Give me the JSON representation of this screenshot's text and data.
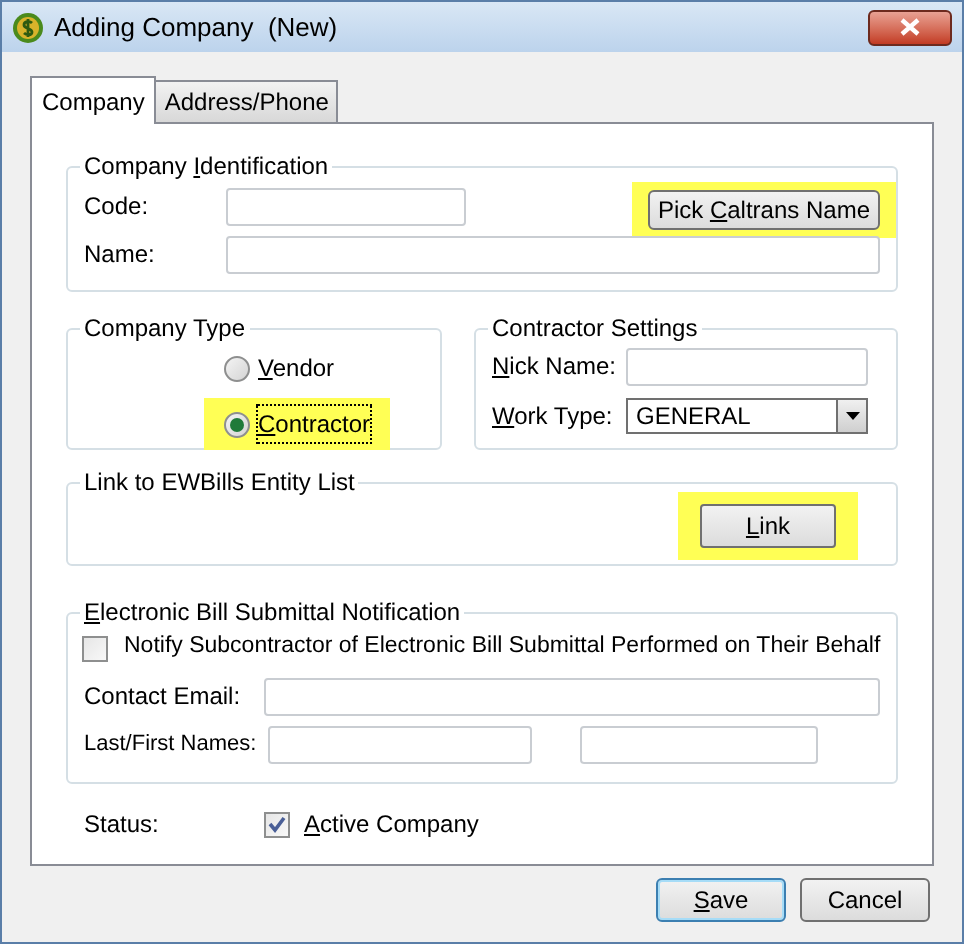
{
  "window": {
    "title": "Adding Company  (New)"
  },
  "tabs": [
    {
      "label": "Company",
      "selected": true
    },
    {
      "label": "Address/Phone",
      "selected": false
    }
  ],
  "company_identification": {
    "title": {
      "text": "Company ",
      "key": "I",
      "rest": "dentification"
    },
    "code_label": "Code:",
    "name_label": "Name:",
    "pick_button": {
      "label": {
        "text": "Pick ",
        "key": "C",
        "rest": "altrans Name"
      },
      "highlighted": true
    }
  },
  "company_type": {
    "title": "Company Type",
    "options": [
      {
        "label": {
          "key": "V",
          "rest": "endor"
        },
        "selected": false,
        "highlighted": false
      },
      {
        "label": {
          "key": "C",
          "rest": "ontractor"
        },
        "selected": true,
        "highlighted": true
      }
    ]
  },
  "contractor_settings": {
    "title": "Contractor Settings",
    "nick_name_label": {
      "key": "N",
      "rest": "ick Name:"
    },
    "work_type_label": {
      "key": "W",
      "rest": "ork Type:"
    },
    "work_type_value": "GENERAL"
  },
  "link_group": {
    "title": "Link to EWBills Entity List",
    "button": {
      "label": {
        "key": "L",
        "rest": "ink"
      },
      "highlighted": true
    }
  },
  "notification": {
    "title": {
      "key": "E",
      "rest": "lectronic Bill Submittal Notification"
    },
    "notify_checkbox": {
      "label": "Notify Subcontractor of Electronic Bill Submittal Performed on Their Behalf",
      "checked": false
    },
    "contact_email_label": "Contact Email:",
    "names_label": "Last/First Names:"
  },
  "status": {
    "label": "Status:",
    "active_checkbox": {
      "label": {
        "key": "A",
        "rest": "ctive Company"
      },
      "checked": true
    }
  },
  "buttons": [
    {
      "label": {
        "key": "S",
        "rest": "ave"
      },
      "default": true
    },
    {
      "label": "Cancel",
      "default": false
    }
  ]
}
